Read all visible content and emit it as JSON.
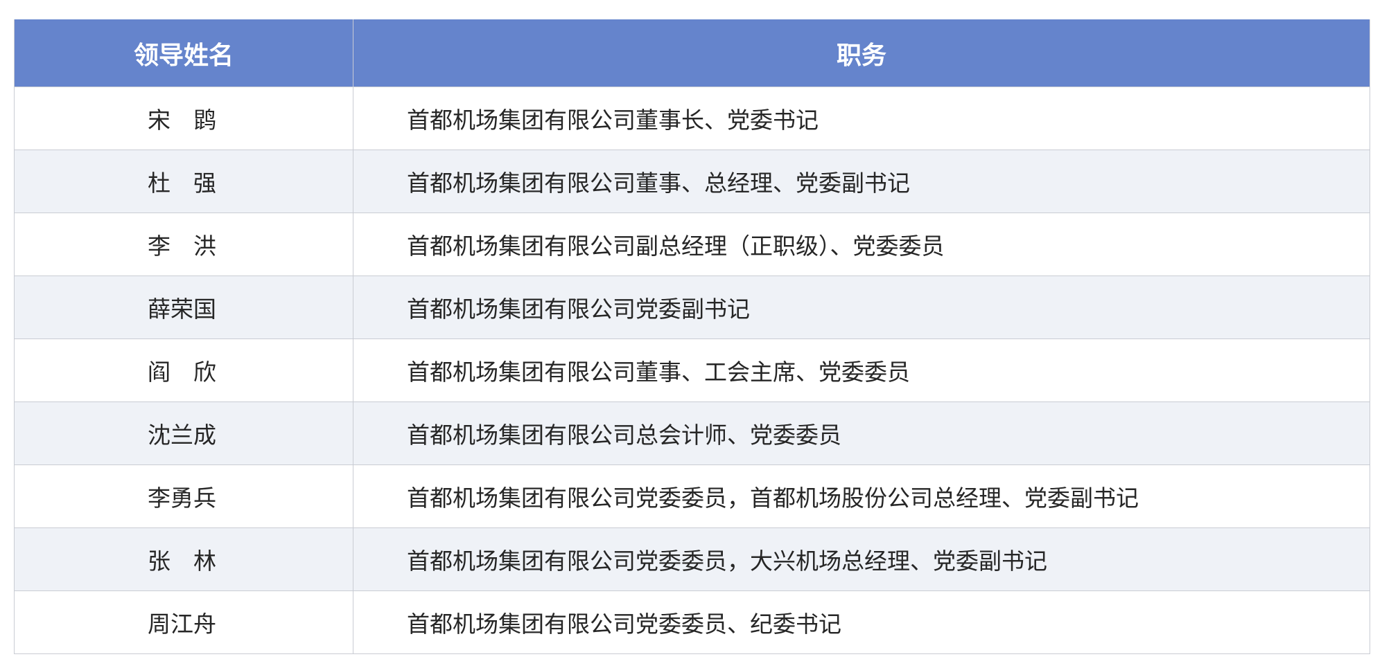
{
  "table": {
    "headers": {
      "name": "领导姓名",
      "duty": "职务"
    },
    "rows": [
      {
        "name": "宋　鹍",
        "duty": "首都机场集团有限公司董事长、党委书记"
      },
      {
        "name": "杜　强",
        "duty": "首都机场集团有限公司董事、总经理、党委副书记"
      },
      {
        "name": "李　洪",
        "duty": "首都机场集团有限公司副总经理（正职级）、党委委员"
      },
      {
        "name": "薛荣国",
        "duty": "首都机场集团有限公司党委副书记"
      },
      {
        "name": "阎　欣",
        "duty": "首都机场集团有限公司董事、工会主席、党委委员"
      },
      {
        "name": "沈兰成",
        "duty": "首都机场集团有限公司总会计师、党委委员"
      },
      {
        "name": "李勇兵",
        "duty": "首都机场集团有限公司党委委员，首都机场股份公司总经理、党委副书记"
      },
      {
        "name": "张　林",
        "duty": "首都机场集团有限公司党委委员，大兴机场总经理、党委副书记"
      },
      {
        "name": "周江舟",
        "duty": "首都机场集团有限公司党委委员、纪委书记"
      }
    ]
  },
  "colors": {
    "header_bg": "#6584cc",
    "header_text": "#ffffff",
    "row_alt_bg": "#eff2f7",
    "border": "#c9ccd3",
    "body_text": "#262626"
  }
}
